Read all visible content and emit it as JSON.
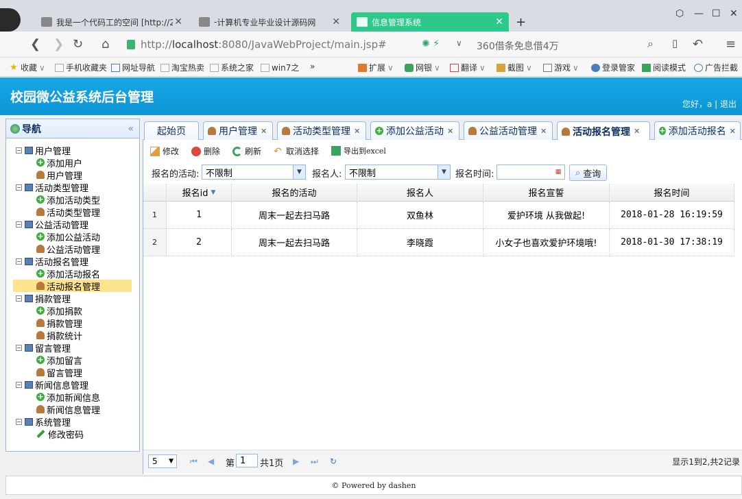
{
  "browser": {
    "tabs": [
      {
        "label": "我是一个代码工的空间 [http://2",
        "active": false
      },
      {
        "label": "计算机专业毕业设计源码网",
        "active": false
      },
      {
        "label": "信息管理系统",
        "active": true
      }
    ],
    "new_tab": "+",
    "url_prefix": "http://",
    "url_host": "localhost",
    "url_rest": ":8080/JavaWebProject/main.jsp#",
    "ad_text": "360借条免息借4万",
    "bookmarks": [
      "收藏",
      "手机收藏夹",
      "网址导航",
      "淘宝热卖",
      "系统之家",
      "win7之",
      "»",
      "扩展",
      "网银",
      "翻译",
      "截图",
      "游戏",
      "登录管家",
      "阅读模式",
      "广告拦截"
    ]
  },
  "app": {
    "title": "校园微公益系统后台管理",
    "greeting": "您好，a | 退出"
  },
  "sidebar": {
    "title": "导航",
    "collapse": "«",
    "groups": [
      {
        "label": "用户管理",
        "items": [
          {
            "label": "添加用户",
            "icon": "add-icon"
          },
          {
            "label": "用户管理",
            "icon": "user-icon"
          }
        ]
      },
      {
        "label": "活动类型管理",
        "items": [
          {
            "label": "添加活动类型",
            "icon": "add-icon"
          },
          {
            "label": "活动类型管理",
            "icon": "user-icon"
          }
        ]
      },
      {
        "label": "公益活动管理",
        "items": [
          {
            "label": "添加公益活动",
            "icon": "add-icon"
          },
          {
            "label": "公益活动管理",
            "icon": "user-icon"
          }
        ]
      },
      {
        "label": "活动报名管理",
        "items": [
          {
            "label": "添加活动报名",
            "icon": "add-icon"
          },
          {
            "label": "活动报名管理",
            "icon": "user-icon",
            "selected": true
          }
        ]
      },
      {
        "label": "捐款管理",
        "items": [
          {
            "label": "添加捐款",
            "icon": "add-icon"
          },
          {
            "label": "捐款管理",
            "icon": "user-icon"
          },
          {
            "label": "捐款统计",
            "icon": "user-icon"
          }
        ]
      },
      {
        "label": "留言管理",
        "items": [
          {
            "label": "添加留言",
            "icon": "add-icon"
          },
          {
            "label": "留言管理",
            "icon": "user-icon"
          }
        ]
      },
      {
        "label": "新闻信息管理",
        "items": [
          {
            "label": "添加新闻信息",
            "icon": "add-icon"
          },
          {
            "label": "新闻信息管理",
            "icon": "user-icon"
          }
        ]
      },
      {
        "label": "系统管理",
        "items": [
          {
            "label": "修改密码",
            "icon": "pen-icon"
          }
        ]
      }
    ]
  },
  "main_tabs": [
    {
      "label": "起始页",
      "closable": false,
      "icon": ""
    },
    {
      "label": "用户管理",
      "closable": true,
      "icon": "user-icon"
    },
    {
      "label": "活动类型管理",
      "closable": true,
      "icon": "user-icon"
    },
    {
      "label": "添加公益活动",
      "closable": true,
      "icon": "add-icon"
    },
    {
      "label": "公益活动管理",
      "closable": true,
      "icon": "user-icon"
    },
    {
      "label": "活动报名管理",
      "closable": true,
      "icon": "user-icon",
      "active": true
    },
    {
      "label": "添加活动报名",
      "closable": true,
      "icon": "add-icon"
    }
  ],
  "toolbar": {
    "edit": "修改",
    "delete": "删除",
    "refresh": "刷新",
    "deselect": "取消选择",
    "export": "导出到excel"
  },
  "filters": {
    "activity_label": "报名的活动:",
    "activity_value": "不限制",
    "person_label": "报名人:",
    "person_value": "不限制",
    "time_label": "报名时间:",
    "time_value": "",
    "query": "查询"
  },
  "grid": {
    "columns": [
      "报名id",
      "报名的活动",
      "报名人",
      "报名宣誓",
      "报名时间"
    ],
    "rows": [
      {
        "rownum": "1",
        "id": "1",
        "activity": "周末一起去扫马路",
        "person": "双鱼林",
        "oath": "爱护环境 从我做起!",
        "time": "2018-01-28 16:19:59"
      },
      {
        "rownum": "2",
        "id": "2",
        "activity": "周末一起去扫马路",
        "person": "李晓霞",
        "oath": "小女子也喜欢爱护环境哦!",
        "time": "2018-01-30 17:38:19"
      }
    ]
  },
  "pager": {
    "page_size": "5",
    "page_prefix": "第",
    "page_num": "1",
    "page_suffix": "共1页",
    "summary": "显示1到2,共2记录"
  },
  "footer": "© Powered by dashen"
}
